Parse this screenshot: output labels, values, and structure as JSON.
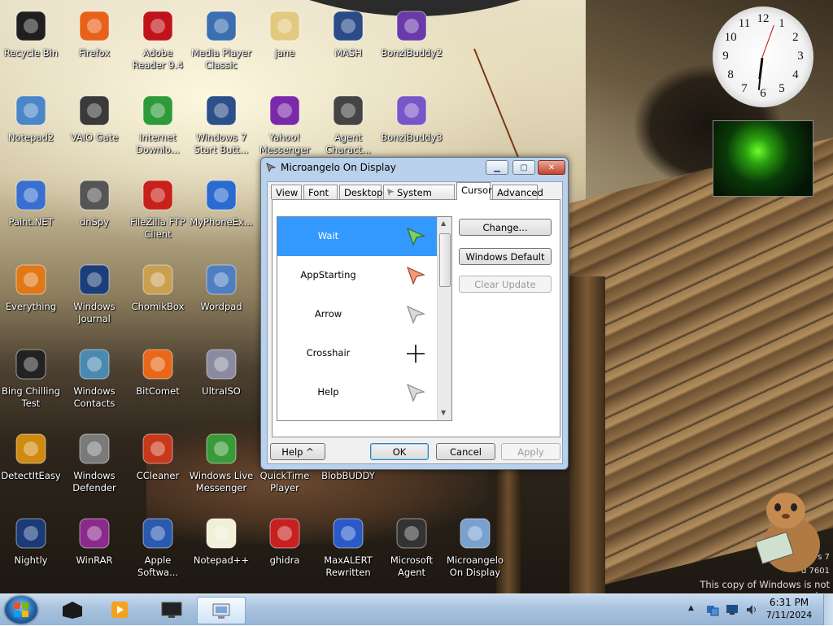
{
  "desktop": {
    "icons": [
      {
        "label": "Recycle Bin",
        "icon": "recycle-bin-icon"
      },
      {
        "label": "Firefox",
        "icon": "firefox-icon"
      },
      {
        "label": "Adobe Reader 9.4",
        "icon": "adobe-reader-icon"
      },
      {
        "label": "Media Player Classic",
        "icon": "media-player-classic-icon"
      },
      {
        "label": "jane",
        "icon": "jane-agent-icon"
      },
      {
        "label": "MASH",
        "icon": "mash-icon"
      },
      {
        "label": "BonziBuddy2",
        "icon": "bonzibuddy-icon"
      },
      {
        "label": "Notepad2",
        "icon": "notepad2-icon"
      },
      {
        "label": "VAIO Gate",
        "icon": "vaio-gate-icon"
      },
      {
        "label": "Internet Downlo...",
        "icon": "internet-download-manager-icon"
      },
      {
        "label": "Windows 7 Start Butt...",
        "icon": "windows7-start-button-icon"
      },
      {
        "label": "Yahoo! Messenger",
        "icon": "yahoo-messenger-icon"
      },
      {
        "label": "Agent Charact...",
        "icon": "agent-character-icon"
      },
      {
        "label": "BonziBuddy3",
        "icon": "bonzibuddy3-icon"
      },
      {
        "label": "Paint.NET",
        "icon": "paint-net-icon"
      },
      {
        "label": "dnSpy",
        "icon": "dnspy-icon"
      },
      {
        "label": "FileZilla FTP Client",
        "icon": "filezilla-icon"
      },
      {
        "label": "MyPhoneEx...",
        "icon": "myphoneexplorer-icon"
      },
      {
        "label": "Everything",
        "icon": "everything-search-icon"
      },
      {
        "label": "Windows Journal",
        "icon": "windows-journal-icon"
      },
      {
        "label": "ChomikBox",
        "icon": "chomikbox-icon"
      },
      {
        "label": "Wordpad",
        "icon": "wordpad-icon"
      },
      {
        "label": "Bing Chilling Test",
        "icon": "bing-chilling-icon"
      },
      {
        "label": "Windows Contacts",
        "icon": "windows-contacts-icon"
      },
      {
        "label": "BitComet",
        "icon": "bitcomet-icon"
      },
      {
        "label": "UltraISO",
        "icon": "ultraiso-icon"
      },
      {
        "label": "DetectItEasy",
        "icon": "detectiteasy-icon"
      },
      {
        "label": "Windows Defender",
        "icon": "windows-defender-icon"
      },
      {
        "label": "CCleaner",
        "icon": "ccleaner-icon"
      },
      {
        "label": "Windows Live Messenger",
        "icon": "windows-live-messenger-icon"
      },
      {
        "label": "QuickTime Player",
        "icon": "quicktime-icon"
      },
      {
        "label": "BlobBUDDY",
        "icon": "blobbuddy-icon"
      },
      {
        "label": "Nightly",
        "icon": "firefox-nightly-icon"
      },
      {
        "label": "WinRAR",
        "icon": "winrar-icon"
      },
      {
        "label": "Apple Softwa...",
        "icon": "apple-software-update-icon"
      },
      {
        "label": "Notepad++",
        "icon": "notepad-plus-plus-icon"
      },
      {
        "label": "ghidra",
        "icon": "ghidra-icon"
      },
      {
        "label": "MaxALERT Rewritten",
        "icon": "maxalert-icon"
      },
      {
        "label": "Microsoft Agent",
        "icon": "microsoft-agent-icon"
      },
      {
        "label": "Microangelo On Display",
        "icon": "microangelo-icon"
      }
    ],
    "watermark": {
      "line_version": "s 7",
      "line_build": "d 7601",
      "line_genuine": "This copy of Windows is not genuine"
    }
  },
  "clock": {
    "numbers": [
      "12",
      "1",
      "2",
      "3",
      "4",
      "5",
      "6",
      "7",
      "8",
      "9",
      "10",
      "11"
    ]
  },
  "dialog": {
    "title": "Microangelo On Display",
    "title_buttons": {
      "minimize": "▁",
      "maximize": "▢",
      "close": "✕"
    },
    "tabs": [
      {
        "label": "View"
      },
      {
        "label": "Font"
      },
      {
        "label": "Desktop"
      },
      {
        "label": "System Icons"
      },
      {
        "label": "Cursor"
      },
      {
        "label": "Advanced"
      }
    ],
    "active_tab": "Cursor",
    "cursor_list": [
      {
        "label": "Wait",
        "selected": true,
        "cursor": "wait-arrow-green"
      },
      {
        "label": "AppStarting",
        "selected": false,
        "cursor": "appstarting-arrow-orange"
      },
      {
        "label": "Arrow",
        "selected": false,
        "cursor": "arrow-grey"
      },
      {
        "label": "Crosshair",
        "selected": false,
        "cursor": "crosshair"
      },
      {
        "label": "Help",
        "selected": false,
        "cursor": "help-arrow-grey"
      }
    ],
    "side_buttons": {
      "change": "Change...",
      "windows_default": "Windows Default",
      "clear_update": "Clear Update"
    },
    "bottom_buttons": {
      "help": "Help ^",
      "ok": "OK",
      "cancel": "Cancel",
      "apply": "Apply"
    }
  },
  "taskbar": {
    "items": [
      {
        "icon": "black-box-icon"
      },
      {
        "icon": "media-player-orange-icon"
      },
      {
        "icon": "monitor-dark-icon"
      },
      {
        "icon": "microangelo-taskbar-icon",
        "active": true
      }
    ],
    "tray": {
      "time": "6:31 PM",
      "date": "7/11/2024",
      "icons": [
        "show-hidden-icons-arrow",
        "network-icon",
        "display-icon",
        "volume-icon"
      ]
    }
  },
  "colors": {
    "selection": "#3399ff",
    "dialog_frame": "#b9d1ea",
    "taskbar": "#a9c3de"
  }
}
